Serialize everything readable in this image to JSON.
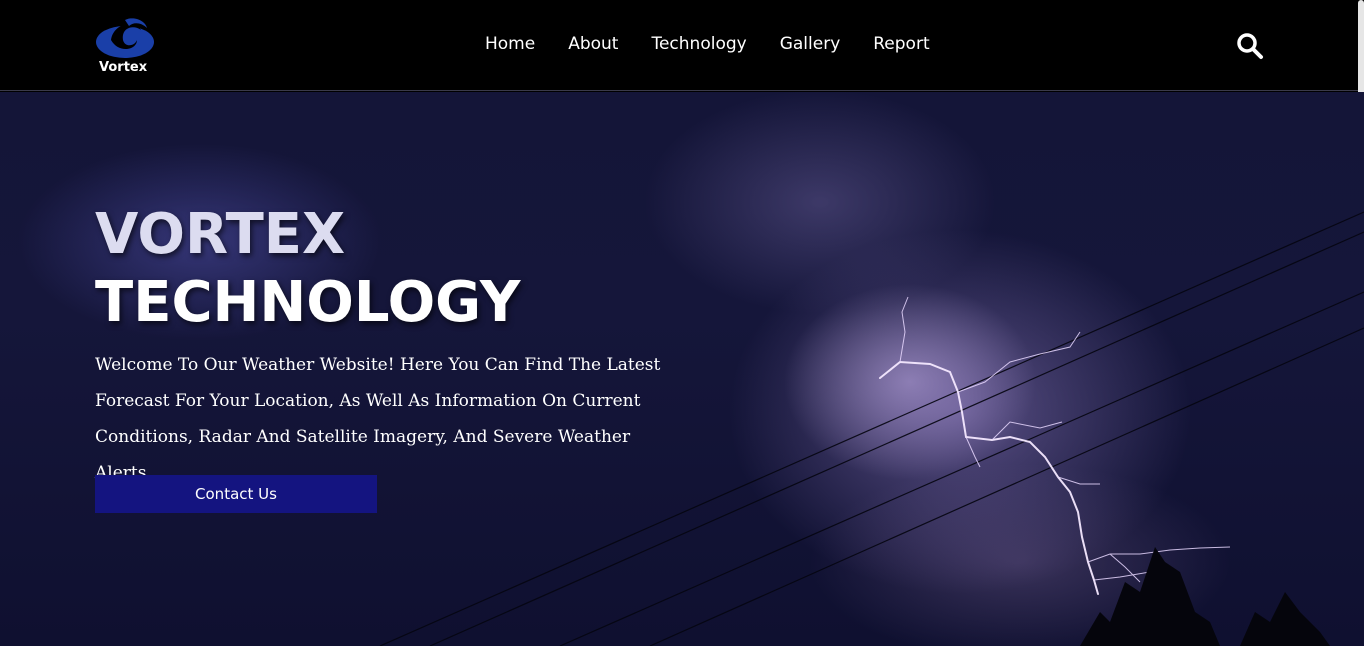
{
  "header": {
    "logo_text": "Vortex",
    "nav": [
      "Home",
      "About",
      "Technology",
      "Gallery",
      "Report"
    ],
    "search_icon": "search-icon"
  },
  "hero": {
    "title_line1": "VORTEX",
    "title_line2": "TECHNOLOGY",
    "description": "Welcome To Our Weather Website! Here You Can Find The Latest Forecast For Your Location, As Well As Information On Current Conditions, Radar And Satellite Imagery, And Severe Weather Alerts.",
    "cta_label": "Contact Us"
  },
  "colors": {
    "header_bg": "#000000",
    "hero_bg": "#15163a",
    "cta_bg": "#141480",
    "logo_blue": "#1a3fa8"
  }
}
